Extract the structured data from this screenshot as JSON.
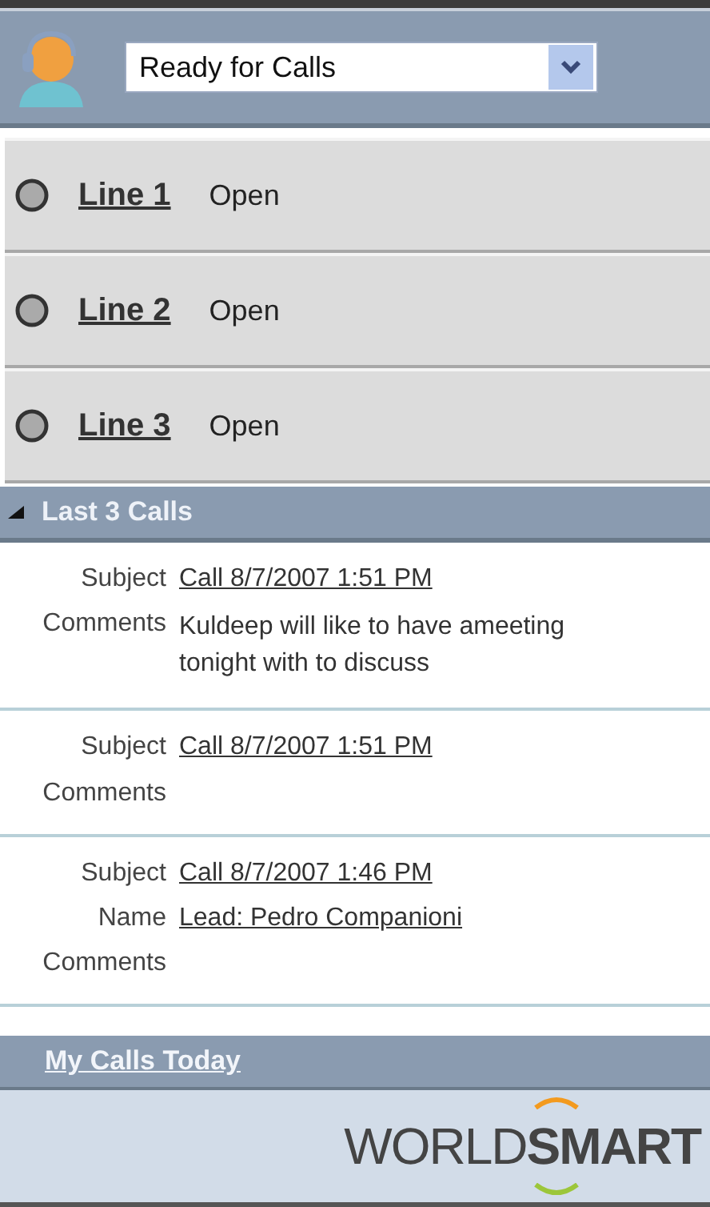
{
  "status": {
    "value": "Ready for Calls"
  },
  "lines": [
    {
      "label": "Line 1",
      "state": "Open"
    },
    {
      "label": "Line 2",
      "state": "Open"
    },
    {
      "label": "Line 3",
      "state": "Open"
    }
  ],
  "last_calls": {
    "title": "Last 3 Calls",
    "expanded": true,
    "calls": [
      {
        "fields": [
          {
            "label": "Subject",
            "value": "Call 8/7/2007 1:51 PM",
            "kind": "link"
          },
          {
            "label": "Comments",
            "value": "Kuldeep will like to have ameeting tonight with to discuss",
            "kind": "text"
          }
        ]
      },
      {
        "fields": [
          {
            "label": "Subject",
            "value": "Call 8/7/2007 1:51 PM",
            "kind": "link"
          },
          {
            "label": "Comments"
          }
        ]
      },
      {
        "fields": [
          {
            "label": "Subject",
            "value": "Call 8/7/2007 1:46 PM",
            "kind": "link"
          },
          {
            "label": "Name",
            "value": "Lead: Pedro Companioni",
            "kind": "link"
          },
          {
            "label": "Comments"
          }
        ]
      }
    ]
  },
  "footer_link": "My Calls Today",
  "logo": "WORLD**SMART**"
}
